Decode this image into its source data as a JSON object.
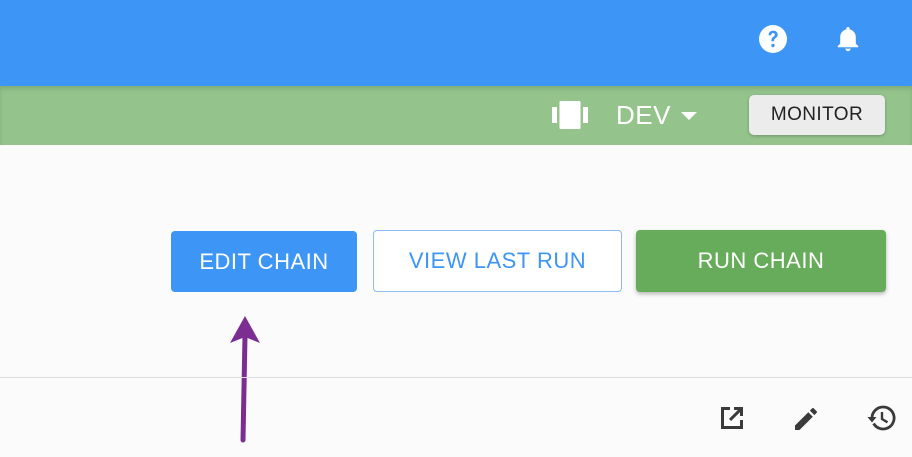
{
  "header": {
    "icons": [
      "help-icon",
      "notifications-bell-icon"
    ],
    "background": "#3d95f5"
  },
  "subheader": {
    "background": "#94c48c",
    "environment_icon": "server-cluster-icon",
    "environment": "DEV",
    "monitor_label": "MONITOR"
  },
  "actions": {
    "edit_chain_label": "EDIT CHAIN",
    "view_last_run_label": "VIEW LAST RUN",
    "run_chain_label": "RUN CHAIN",
    "primary_color": "#3d95f5",
    "success_color": "#67ac5a"
  },
  "toolbar": {
    "icons": [
      "open-in-new-icon",
      "edit-pencil-icon",
      "history-icon"
    ]
  },
  "annotation": {
    "arrow_color": "#7b2d91",
    "points_to": "EDIT CHAIN"
  }
}
